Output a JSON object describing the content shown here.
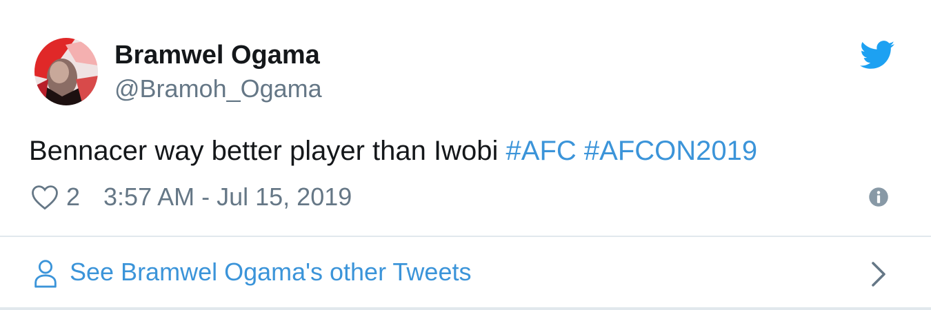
{
  "tweet": {
    "author": {
      "display_name": "Bramwel Ogama",
      "handle": "@Bramoh_Ogama",
      "avatar_icon": "avatar-image"
    },
    "text_plain": "Bennacer way better player than Iwobi ",
    "hashtags": [
      "#AFC",
      "#AFCON2019"
    ],
    "likes": "2",
    "timestamp": "3:57 AM - Jul 15, 2019",
    "icons": {
      "brand": "twitter-bird-icon",
      "like": "heart-icon",
      "info": "info-icon"
    }
  },
  "footer": {
    "see_more_label": "See Bramwel Ogama's other Tweets",
    "icons": {
      "person": "person-icon",
      "chevron": "chevron-right-icon"
    }
  },
  "colors": {
    "text": "#14171a",
    "secondary": "#657786",
    "link": "#3b94d9",
    "twitter_blue": "#1da1f2",
    "border": "#e1e8ed"
  }
}
